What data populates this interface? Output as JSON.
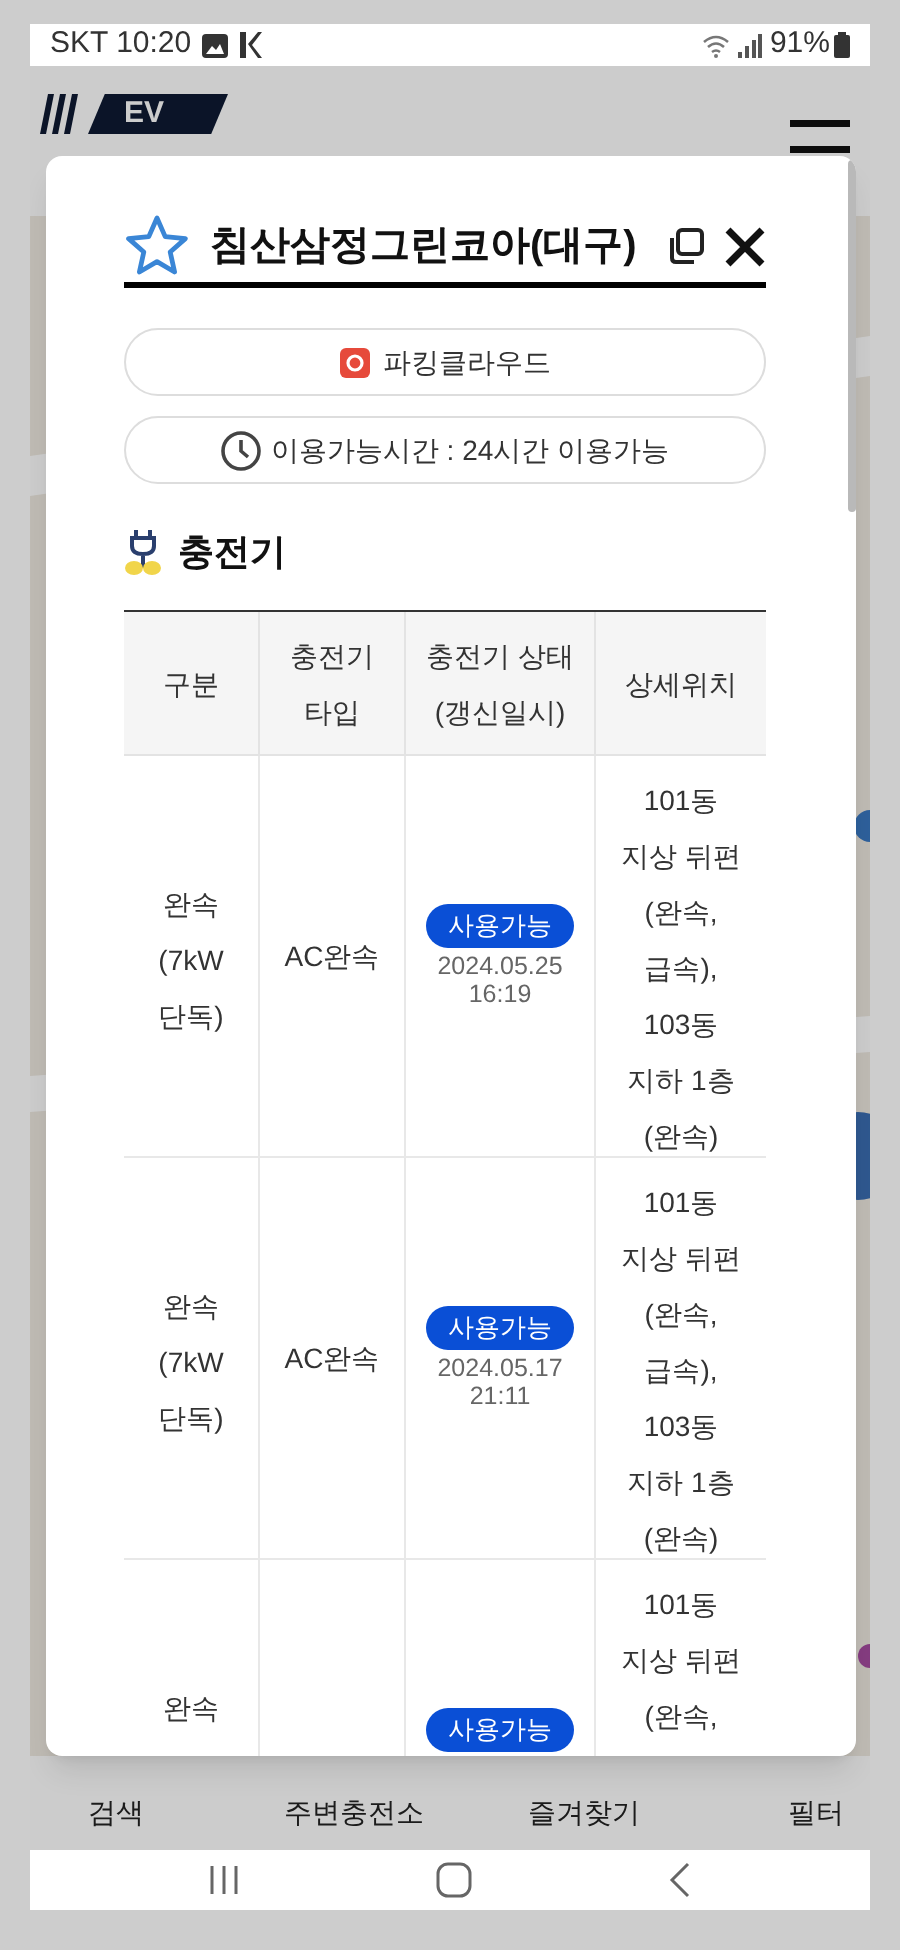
{
  "status_bar": {
    "carrier_time": "SKT 10:20",
    "battery": "91%"
  },
  "app": {
    "logo": "EV",
    "bottom_tabs": [
      "검색",
      "주변충전소",
      "즐겨찾기",
      "필터"
    ]
  },
  "modal": {
    "title": "침산삼정그린코아(대구)",
    "favorite": false,
    "operator": "파킹클라우드",
    "hours": "이용가능시간 : 24시간 이용가능",
    "section_title": "충전기",
    "table": {
      "columns": [
        "구분",
        "충전기\n타입",
        "충전기 상태\n(갱신일시)",
        "상세위치"
      ],
      "rows": [
        {
          "speed": "완속\n(7kW\n단독)",
          "type": "AC완속",
          "status": {
            "label": "사용가능",
            "kind": "available",
            "updated": "2024.05.25\n16:19"
          },
          "location": "101동\n지상 뒤편\n(완속,\n급속),\n103동\n지하 1층\n(완속)"
        },
        {
          "speed": "완속\n(7kW\n단독)",
          "type": "AC완속",
          "status": {
            "label": "사용가능",
            "kind": "available",
            "updated": "2024.05.17\n21:11"
          },
          "location": "101동\n지상 뒤편\n(완속,\n급속),\n103동\n지하 1층\n(완속)"
        },
        {
          "speed": "완속",
          "status": {
            "label": "사용가능",
            "kind": "available"
          },
          "location": "101동\n지상 뒤편\n(완속,"
        }
      ]
    }
  }
}
